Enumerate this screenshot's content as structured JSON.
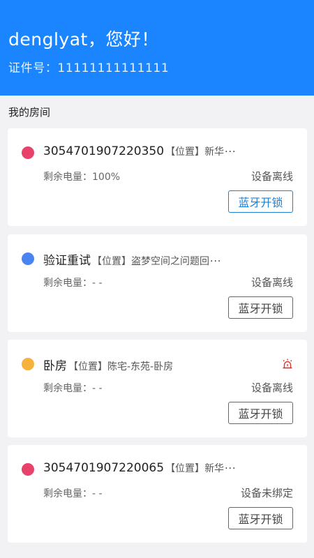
{
  "header": {
    "greeting": "denglyat，您好！",
    "id_label": "证件号：",
    "id_value": "11111111111111",
    "bg_color": "#1a85ff"
  },
  "section_title": "我的房间",
  "rooms": [
    {
      "name": "3054701907220350",
      "location_tag": "【位置】",
      "location": "新华",
      "battery_label": "剩余电量：",
      "battery_value": "100%",
      "status": "设备离线",
      "button_label": "蓝牙开锁",
      "dot_color": "#e8416a",
      "has_alarm": false
    },
    {
      "name": "验证重试",
      "location_tag": "【位置】",
      "location": "盗梦空间之问题回",
      "battery_label": "剩余电量：",
      "battery_value": "- -",
      "status": "设备离线",
      "button_label": "蓝牙开锁",
      "dot_color": "#4a84f0",
      "has_alarm": false
    },
    {
      "name": "卧房",
      "location_tag": "【位置】",
      "location": "陈宅-东苑-卧房",
      "battery_label": "剩余电量：",
      "battery_value": "- -",
      "status": "设备离线",
      "button_label": "蓝牙开锁",
      "dot_color": "#f7b23b",
      "has_alarm": true,
      "alarm_icon": "alarm-icon"
    },
    {
      "name": "3054701907220065",
      "location_tag": "【位置】",
      "location": "新华",
      "battery_label": "剩余电量：",
      "battery_value": "- -",
      "status": "设备未绑定",
      "button_label": "蓝牙开锁",
      "dot_color": "#e8416a",
      "has_alarm": false
    }
  ],
  "ellipsis": "···"
}
